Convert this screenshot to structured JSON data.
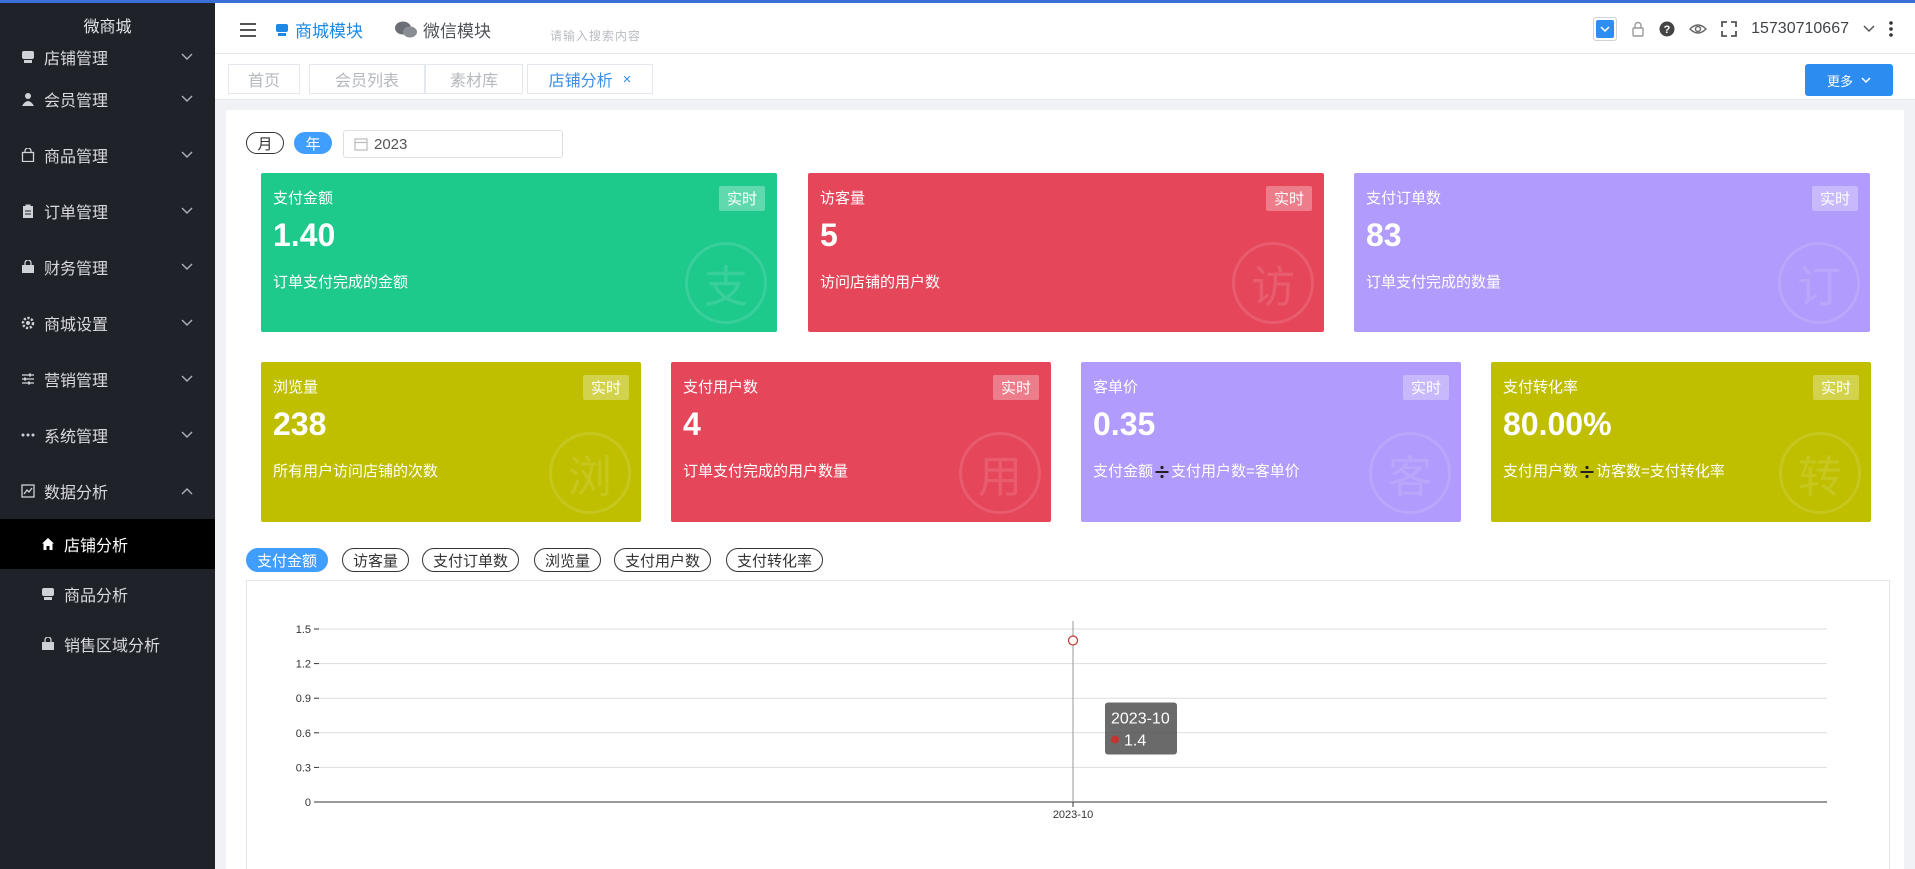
{
  "brand": "微商城",
  "menu": [
    {
      "label": "店铺管理",
      "icon": "store-icon",
      "expanded": false
    },
    {
      "label": "会员管理",
      "icon": "user-icon",
      "expanded": false
    },
    {
      "label": "商品管理",
      "icon": "shopping-bag-icon",
      "expanded": false
    },
    {
      "label": "订单管理",
      "icon": "clipboard-icon",
      "expanded": false
    },
    {
      "label": "财务管理",
      "icon": "wallet-icon",
      "expanded": false
    },
    {
      "label": "商城设置",
      "icon": "gear-icon",
      "expanded": false
    },
    {
      "label": "营销管理",
      "icon": "sliders-icon",
      "expanded": false
    },
    {
      "label": "系统管理",
      "icon": "more-dots-icon",
      "expanded": false
    },
    {
      "label": "数据分析",
      "icon": "chart-icon",
      "expanded": true
    }
  ],
  "submenu": [
    {
      "label": "店铺分析",
      "icon": "home-icon",
      "active": true
    },
    {
      "label": "商品分析",
      "icon": "store-icon",
      "active": false
    },
    {
      "label": "销售区域分析",
      "icon": "wallet-icon",
      "active": false
    }
  ],
  "header": {
    "module_mall": "商城模块",
    "module_wechat": "微信模块",
    "search_placeholder": "请输入搜索内容",
    "user_phone": "15730710667"
  },
  "tabs": [
    {
      "label": "首页",
      "active": false
    },
    {
      "label": "会员列表",
      "active": false
    },
    {
      "label": "素材库",
      "active": false
    },
    {
      "label": "店铺分析",
      "active": true,
      "close": "×"
    }
  ],
  "more_button": "更多",
  "filter": {
    "month": "月",
    "year": "年",
    "date_value": "2023"
  },
  "cards_row1": [
    {
      "title": "支付金额",
      "badge": "实时",
      "value": "1.40",
      "desc": "订单支付完成的金额",
      "wm": "支",
      "color": "#1ec98c"
    },
    {
      "title": "访客量",
      "badge": "实时",
      "value": "5",
      "desc": "访问店铺的用户数",
      "wm": "访",
      "color": "#e5465a"
    },
    {
      "title": "支付订单数",
      "badge": "实时",
      "value": "83",
      "desc": "订单支付完成的数量",
      "wm": "订",
      "color": "#b19bfc"
    }
  ],
  "cards_row2": [
    {
      "title": "浏览量",
      "badge": "实时",
      "value": "238",
      "desc": "所有用户访问店铺的次数",
      "wm": "浏",
      "color": "#bfbf00"
    },
    {
      "title": "支付用户数",
      "badge": "实时",
      "value": "4",
      "desc": "订单支付完成的用户数量",
      "wm": "用",
      "color": "#e5465a"
    },
    {
      "title": "客单价",
      "badge": "实时",
      "value": "0.35",
      "desc_a": "支付金额",
      "desc_b": "支付用户数=客单价",
      "wm": "客",
      "color": "#b19bfc"
    },
    {
      "title": "支付转化率",
      "badge": "实时",
      "value": "80.00%",
      "desc_a": "支付用户数",
      "desc_b": "访客数=支付转化率",
      "wm": "转",
      "color": "#bfbf00"
    }
  ],
  "metric_tabs": [
    {
      "label": "支付金额",
      "active": true
    },
    {
      "label": "访客量",
      "active": false
    },
    {
      "label": "支付订单数",
      "active": false
    },
    {
      "label": "浏览量",
      "active": false
    },
    {
      "label": "支付用户数",
      "active": false
    },
    {
      "label": "支付转化率",
      "active": false
    }
  ],
  "chart_data": {
    "type": "line",
    "categories": [
      "2023-10"
    ],
    "series": [
      {
        "values": [
          1.4
        ]
      }
    ],
    "ylim": [
      0,
      1.5
    ],
    "yticks": [
      "0",
      "0.3",
      "0.6",
      "0.9",
      "1.2",
      "1.5"
    ],
    "grid": true,
    "tooltip": {
      "title": "2023-10",
      "value": "1.4"
    }
  }
}
